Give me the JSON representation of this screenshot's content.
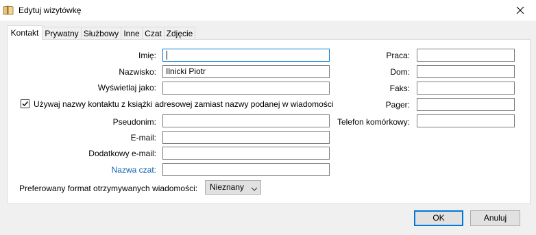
{
  "window": {
    "title": "Edytuj wizytówkę"
  },
  "tabs": [
    {
      "label": "Kontakt",
      "active": true
    },
    {
      "label": "Prywatny"
    },
    {
      "label": "Służbowy"
    },
    {
      "label": "Inne"
    },
    {
      "label": "Czat"
    },
    {
      "label": "Zdjęcie"
    }
  ],
  "form": {
    "imie_label": "Imię:",
    "imie_value": "",
    "nazwisko_label": "Nazwisko:",
    "nazwisko_value": "Ilnicki Piotr",
    "wyswietlaj_label": "Wyświetlaj jako:",
    "wyswietlaj_value": "",
    "use_name_checkbox_label": "Używaj nazwy kontaktu z książki adresowej zamiast nazwy podanej w wiadomości",
    "use_name_checked": true,
    "pseudonim_label": "Pseudonim:",
    "pseudonim_value": "",
    "email_label": "E-mail:",
    "email_value": "",
    "dodatkowy_email_label": "Dodatkowy e-mail:",
    "dodatkowy_email_value": "",
    "nazwa_czat_label": "Nazwa czat:",
    "nazwa_czat_value": "",
    "format_label": "Preferowany format otrzymywanych wiadomości:",
    "format_value": "Nieznany"
  },
  "phones": {
    "praca_label": "Praca:",
    "dom_label": "Dom:",
    "faks_label": "Faks:",
    "pager_label": "Pager:",
    "telefon_label": "Telefon komórkowy:"
  },
  "buttons": {
    "ok": "OK",
    "cancel": "Anuluj"
  },
  "colors": {
    "accent": "#0078d7",
    "link_label": "#0c62b3"
  }
}
